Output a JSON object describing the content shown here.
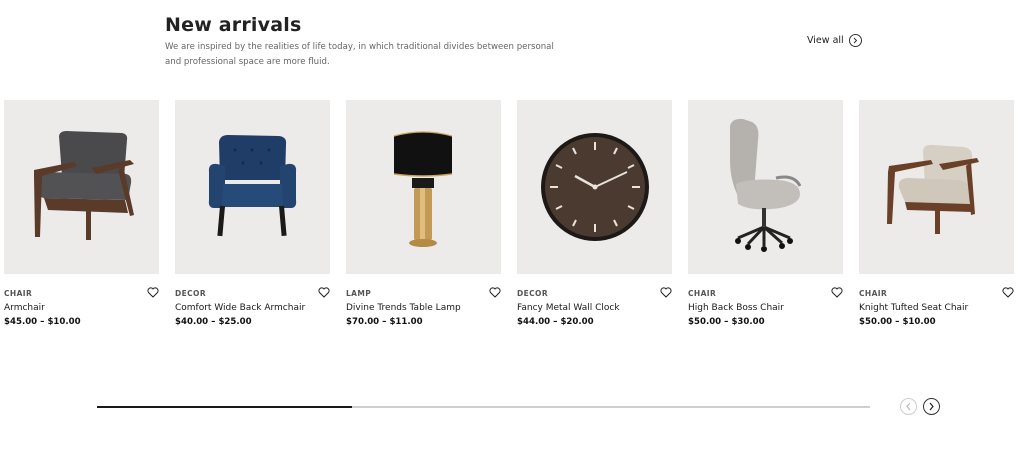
{
  "header": {
    "title": "New arrivals",
    "description": "We are inspired by the realities of life today, in which traditional divides between personal and professional space are more fluid.",
    "view_all_label": "View all"
  },
  "products": [
    {
      "category": "CHAIR",
      "name": "Armchair",
      "price": "$45.00 – $10.00",
      "image": "armchair"
    },
    {
      "category": "DECOR",
      "name": "Comfort Wide Back Armchair",
      "price": "$40.00 – $25.00",
      "image": "blue-tufted-armchair"
    },
    {
      "category": "LAMP",
      "name": "Divine Trends Table Lamp",
      "price": "$70.00 – $11.00",
      "image": "table-lamp"
    },
    {
      "category": "DECOR",
      "name": "Fancy Metal Wall Clock",
      "price": "$44.00 – $20.00",
      "image": "wall-clock"
    },
    {
      "category": "CHAIR",
      "name": "High Back Boss Chair",
      "price": "$50.00 – $30.00",
      "image": "office-chair"
    },
    {
      "category": "CHAIR",
      "name": "Knight Tufted Seat Chair",
      "price": "$50.00 – $10.00",
      "image": "cream-armchair"
    }
  ],
  "carousel": {
    "progress": 0.33,
    "prev_icon": "chevron-left-icon",
    "next_icon": "chevron-right-icon"
  },
  "colors": {
    "card_background": "#ecebe9",
    "progress_fill": "#1a1a1a",
    "progress_track": "#cfcfcf"
  }
}
